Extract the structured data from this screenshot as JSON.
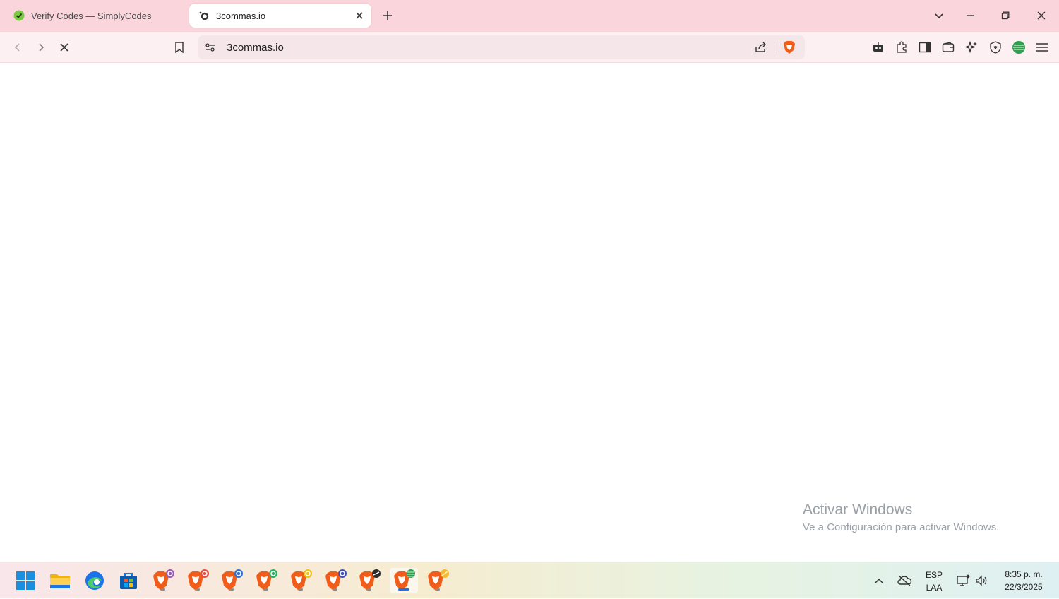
{
  "tabs": [
    {
      "title": "Verify Codes — SimplyCodes",
      "active": false
    },
    {
      "title": "3commas.io",
      "active": true
    }
  ],
  "address_bar": {
    "url": "3commas.io"
  },
  "watermark": {
    "line1": "Activar Windows",
    "line2": "Ve a Configuración para activar Windows."
  },
  "taskbar": {
    "apps": [
      "windows-start",
      "file-explorer",
      "edge",
      "microsoft-store",
      "brave-profile-1",
      "brave-profile-2",
      "brave-profile-3",
      "brave-profile-4",
      "brave-profile-5",
      "brave-profile-6",
      "brave-profile-7",
      "brave-profile-8",
      "brave-profile-9"
    ],
    "language": {
      "code": "ESP",
      "layout": "LAA"
    },
    "clock": {
      "time": "8:35 p. m.",
      "date": "22/3/2025"
    }
  },
  "colors": {
    "titlebar": "#fbd5dc",
    "toolbar": "#fdf0f2",
    "brave_orange": "#f25c19"
  }
}
